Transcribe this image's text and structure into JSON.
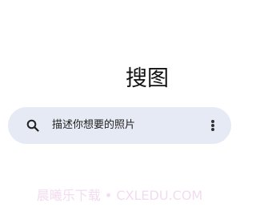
{
  "header": {
    "title": "搜图"
  },
  "search": {
    "placeholder": "描述你想要的照片",
    "icon": "search-icon",
    "menu_icon": "more-vertical-icon"
  },
  "watermark": {
    "text": "晨曦乐下载 • CXLEDU.COM"
  },
  "colors": {
    "background": "#ffffff",
    "search_bar": "#e6eaf4",
    "text": "#111111",
    "watermark": "#f2dcef"
  }
}
